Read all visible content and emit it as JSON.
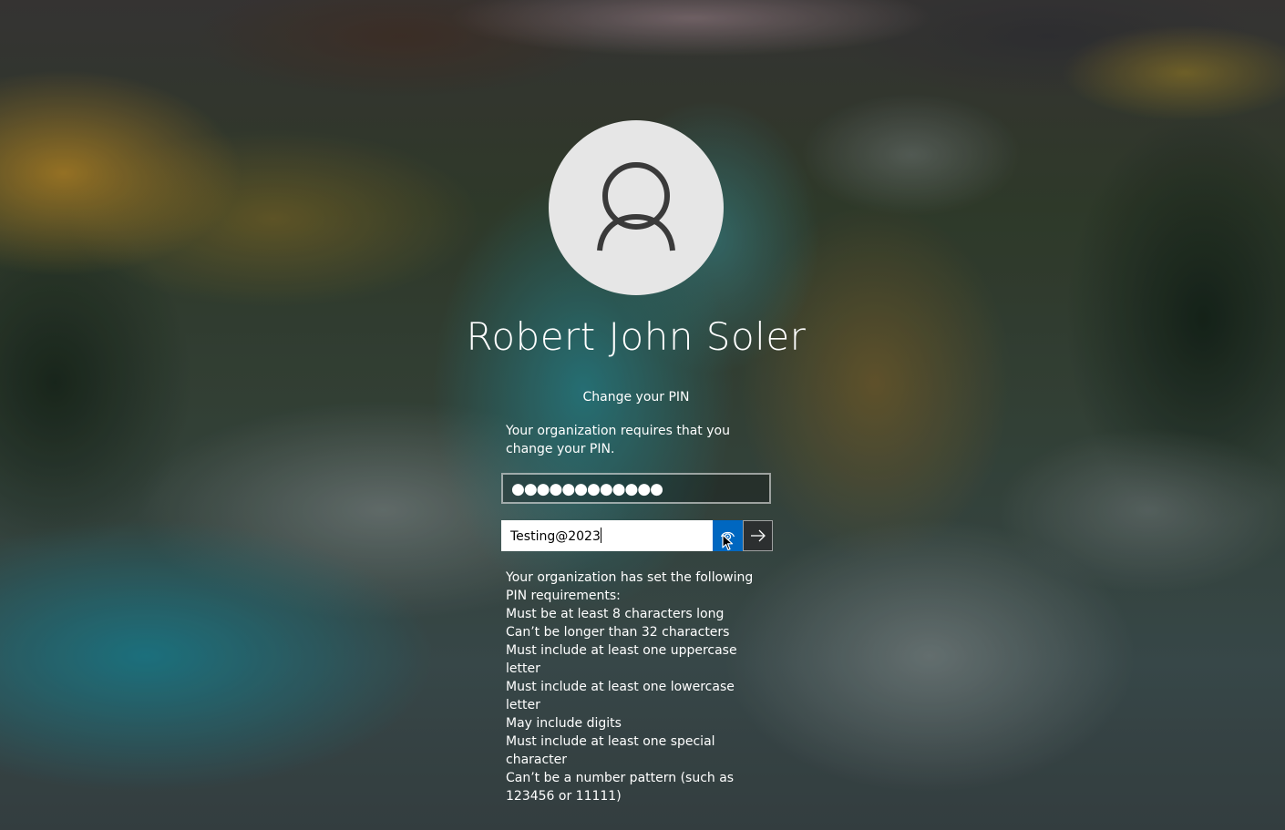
{
  "user": {
    "name": "Robert John Soler"
  },
  "pin_change": {
    "title": "Change your PIN",
    "message": "Your organization requires that you change your PIN.",
    "current_pin_masked": "●●●●●●●●●●●●",
    "new_pin_value": "Testing@2023",
    "reveal_icon": "eye-reveal-icon",
    "submit_icon": "arrow-right-icon",
    "accent_color": "#0067c0"
  },
  "requirements": {
    "intro": "Your organization has set the following PIN requirements:",
    "items": [
      "Must be at least 8 characters long",
      "Can’t be longer than 32 characters",
      "Must include at least one uppercase letter",
      "Must include at least one lowercase letter",
      "May include digits",
      "Must include at least one special character",
      "Can’t be a number pattern (such as 123456 or 11111)"
    ]
  }
}
